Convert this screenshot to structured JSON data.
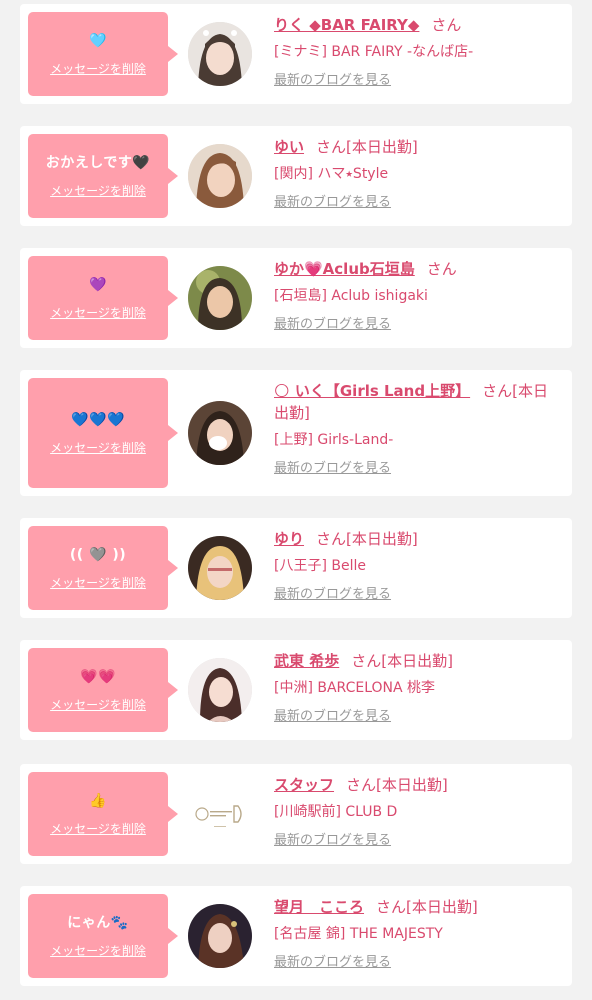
{
  "ui": {
    "delete_label": "メッセージを削除",
    "blog_label": "最新のブログを見る",
    "san": "さん"
  },
  "cards": [
    {
      "message": "🩵",
      "name": "りく ◆BAR FAIRY◆",
      "status": "",
      "shop": "[ミナミ] BAR FAIRY -なんば店-",
      "avatar_icon": "avatar-photo"
    },
    {
      "message": "おかえしです🖤",
      "name": "ゆい",
      "status": "[本日出勤]",
      "shop": "[関内] ハマ⭑Style",
      "avatar_icon": "avatar-photo"
    },
    {
      "message": "💜",
      "name": "ゆか💗Aclub石垣島",
      "status": "",
      "shop": "[石垣島] Aclub ishigaki",
      "avatar_icon": "avatar-photo"
    },
    {
      "message": "💙💙💙",
      "name": "🌕 いく【Girls Land上野】",
      "status": "[本日出勤]",
      "shop": "[上野] Girls-Land-",
      "avatar_icon": "avatar-photo"
    },
    {
      "message": "(( 🩶 ))",
      "name": "ゆり",
      "status": "[本日出勤]",
      "shop": "[八王子] Belle",
      "avatar_icon": "avatar-photo"
    },
    {
      "message": "💗💗",
      "name": "武東 希歩",
      "status": "[本日出勤]",
      "shop": "[中洲] BARCELONA 桃李",
      "avatar_icon": "avatar-photo"
    },
    {
      "message": "👍",
      "name": "スタッフ",
      "status": "[本日出勤]",
      "shop": "[川崎駅前] CLUB D",
      "avatar_icon": "club-d-logo"
    },
    {
      "message": "にゃん🐾",
      "name": "望月　こころ",
      "status": "[本日出勤]",
      "shop": "[名古屋 錦] THE MAJESTY",
      "avatar_icon": "avatar-photo"
    }
  ],
  "colors": {
    "bubble": "#ff9fac",
    "accent": "#d94a6e",
    "link_gray": "#999999",
    "background": "#f2f2f2"
  }
}
